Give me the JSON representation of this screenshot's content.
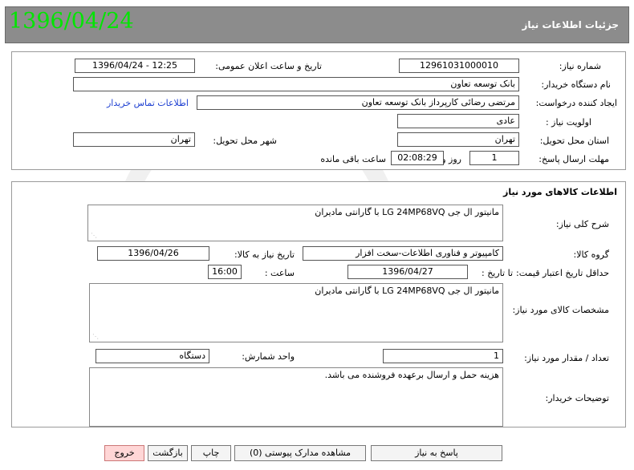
{
  "header": {
    "title": "جزئیات اطلاعات نیاز",
    "date_stamp": "1396/04/24"
  },
  "info": {
    "need_number_label": "شماره نیاز:",
    "need_number": "12961031000010",
    "announce_label": "تاریخ و ساعت اعلان عمومی:",
    "announce_value": "1396/04/24 - 12:25",
    "buyer_org_label": "نام دستگاه خریدار:",
    "buyer_org": "بانک توسعه تعاون",
    "creator_label": "ایجاد کننده درخواست:",
    "creator": "مرتضی رضائی کارپرداز بانک توسعه تعاون",
    "contact_link": "اطلاعات تماس خریدار",
    "priority_label": "اولویت نیاز :",
    "priority": "عادی",
    "province_label": "استان محل تحویل:",
    "province": "تهران",
    "city_label": "شهر محل تحویل:",
    "city": "تهران",
    "deadline_label": "مهلت ارسال پاسخ:",
    "deadline_days": "1",
    "days_word": "روز و",
    "deadline_time": "02:08:29",
    "remaining_label": "ساعت باقی مانده"
  },
  "goods": {
    "section_title": "اطلاعات کالاهای مورد نیاز",
    "summary_label": "شرح کلی نیاز:",
    "summary": "مانیتور ال جی LG 24MP68VQ با گارانتی مادیران",
    "group_label": "گروه کالا:",
    "group": "کامپیوتر و فناوری اطلاعات-سخت افزار",
    "need_date_label": "تاریخ نیاز به کالا:",
    "need_date": "1396/04/26",
    "validity_label": "حداقل تاریخ اعتبار قیمت:",
    "until_label": "تا تاریخ :",
    "validity_date": "1396/04/27",
    "hour_label": "ساعت :",
    "validity_time": "16:00",
    "specs_label": "مشخصات کالای مورد نیاز:",
    "specs": "مانیتور ال جی LG 24MP68VQ با گارانتی مادیران",
    "qty_label": "تعداد / مقدار مورد نیاز:",
    "qty": "1",
    "unit_label": "واحد شمارش:",
    "unit": "دستگاه",
    "buyer_notes_label": "توضیحات خریدار:",
    "buyer_notes": "هزینه حمل و ارسال برعهده فروشنده می باشد."
  },
  "buttons": {
    "reply": "پاسخ به نیاز",
    "attachments": "مشاهده مدارک پیوستی (0)",
    "print": "چاپ",
    "back": "بازگشت",
    "exit": "خروج"
  }
}
